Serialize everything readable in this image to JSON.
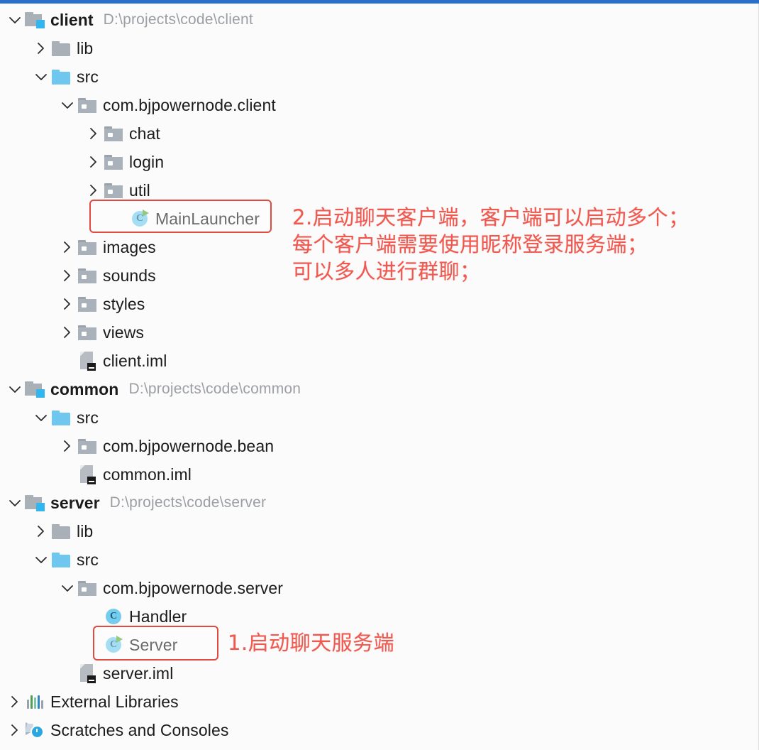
{
  "window": {
    "accent_color": "#2a6fc9",
    "background": "#fbfbfc",
    "annotation_color": "#ef5a50"
  },
  "tree": {
    "nodes": [
      {
        "label": "client",
        "path": "D:\\projects\\code\\client",
        "icon": "module-folder-icon",
        "arrow": "expanded",
        "indent": 0,
        "bold": true
      },
      {
        "label": "lib",
        "path": "",
        "icon": "folder-gray-icon",
        "arrow": "collapsed",
        "indent": 1,
        "bold": false
      },
      {
        "label": "src",
        "path": "",
        "icon": "folder-blue-icon",
        "arrow": "expanded",
        "indent": 1,
        "bold": false
      },
      {
        "label": "com.bjpowernode.client",
        "path": "",
        "icon": "package-folder-icon",
        "arrow": "expanded",
        "indent": 2,
        "bold": false
      },
      {
        "label": "chat",
        "path": "",
        "icon": "package-folder-icon",
        "arrow": "collapsed",
        "indent": 3,
        "bold": false
      },
      {
        "label": "login",
        "path": "",
        "icon": "package-folder-icon",
        "arrow": "collapsed",
        "indent": 3,
        "bold": false
      },
      {
        "label": "util",
        "path": "",
        "icon": "package-folder-icon",
        "arrow": "collapsed",
        "indent": 3,
        "bold": false
      },
      {
        "label": "MainLauncher",
        "path": "",
        "icon": "java-class-runnable-icon",
        "arrow": "none",
        "indent": 4,
        "bold": false
      },
      {
        "label": "images",
        "path": "",
        "icon": "package-folder-icon",
        "arrow": "collapsed",
        "indent": 2,
        "bold": false
      },
      {
        "label": "sounds",
        "path": "",
        "icon": "package-folder-icon",
        "arrow": "collapsed",
        "indent": 2,
        "bold": false
      },
      {
        "label": "styles",
        "path": "",
        "icon": "package-folder-icon",
        "arrow": "collapsed",
        "indent": 2,
        "bold": false
      },
      {
        "label": "views",
        "path": "",
        "icon": "package-folder-icon",
        "arrow": "collapsed",
        "indent": 2,
        "bold": false
      },
      {
        "label": "client.iml",
        "path": "",
        "icon": "iml-file-icon",
        "arrow": "none",
        "indent": 2,
        "bold": false
      },
      {
        "label": "common",
        "path": "D:\\projects\\code\\common",
        "icon": "module-folder-icon",
        "arrow": "expanded",
        "indent": 0,
        "bold": true
      },
      {
        "label": "src",
        "path": "",
        "icon": "folder-blue-icon",
        "arrow": "expanded",
        "indent": 1,
        "bold": false
      },
      {
        "label": "com.bjpowernode.bean",
        "path": "",
        "icon": "package-folder-icon",
        "arrow": "collapsed",
        "indent": 2,
        "bold": false
      },
      {
        "label": "common.iml",
        "path": "",
        "icon": "iml-file-icon",
        "arrow": "none",
        "indent": 2,
        "bold": false
      },
      {
        "label": "server",
        "path": "D:\\projects\\code\\server",
        "icon": "module-folder-icon",
        "arrow": "expanded",
        "indent": 0,
        "bold": true
      },
      {
        "label": "lib",
        "path": "",
        "icon": "folder-gray-icon",
        "arrow": "collapsed",
        "indent": 1,
        "bold": false
      },
      {
        "label": "src",
        "path": "",
        "icon": "folder-blue-icon",
        "arrow": "expanded",
        "indent": 1,
        "bold": false
      },
      {
        "label": "com.bjpowernode.server",
        "path": "",
        "icon": "package-folder-icon",
        "arrow": "expanded",
        "indent": 2,
        "bold": false
      },
      {
        "label": "Handler",
        "path": "",
        "icon": "java-class-icon",
        "arrow": "none",
        "indent": 3,
        "bold": false
      },
      {
        "label": "Server",
        "path": "",
        "icon": "java-class-runnable-icon",
        "arrow": "none",
        "indent": 3,
        "bold": false
      },
      {
        "label": "server.iml",
        "path": "",
        "icon": "iml-file-icon",
        "arrow": "none",
        "indent": 2,
        "bold": false
      },
      {
        "label": "External Libraries",
        "path": "",
        "icon": "external-libraries-icon",
        "arrow": "collapsed",
        "indent": 0,
        "bold": false
      },
      {
        "label": "Scratches and Consoles",
        "path": "",
        "icon": "scratches-icon",
        "arrow": "collapsed",
        "indent": 0,
        "bold": false
      }
    ]
  },
  "annotations": [
    {
      "id": "client-annotation",
      "text": "2.启动聊天客户端，客户端可以启动多个；\n每个客户端需要使用昵称登录服务端；\n可以多人进行群聊；"
    },
    {
      "id": "server-annotation",
      "text": "1.启动聊天服务端"
    }
  ],
  "highlights": [
    {
      "id": "mainlauncher-highlight",
      "target": "MainLauncher"
    },
    {
      "id": "server-highlight",
      "target": "Server"
    }
  ]
}
